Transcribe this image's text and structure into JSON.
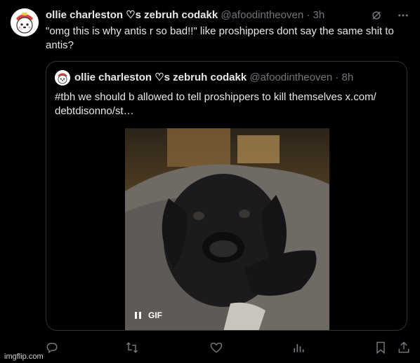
{
  "tweet": {
    "author_name": "ollie charleston ♡s zebruh codakk",
    "handle": "@afoodintheoven",
    "time": "· 3h",
    "text": "\"omg this is why antis r so bad!!\" like proshippers dont say the same shit to antis?"
  },
  "quoted": {
    "author_name": "ollie charleston ♡s zebruh codakk",
    "handle": "@afoodintheoven",
    "time": "· 8h",
    "text": "#tbh we should b allowed to tell proshippers to kill themselves  x.com/ debtdisonno/st…",
    "media_label": "GIF"
  },
  "icons": {
    "top": [
      "grok-icon",
      "more-icon"
    ],
    "actions": [
      "reply-icon",
      "retweet-icon",
      "like-icon",
      "views-icon",
      "bookmark-icon",
      "share-icon"
    ]
  },
  "watermark": "imgflip.com",
  "colors": {
    "background": "#000000",
    "text": "#e7e9ea",
    "muted": "#71767b",
    "border": "#2f3336"
  }
}
